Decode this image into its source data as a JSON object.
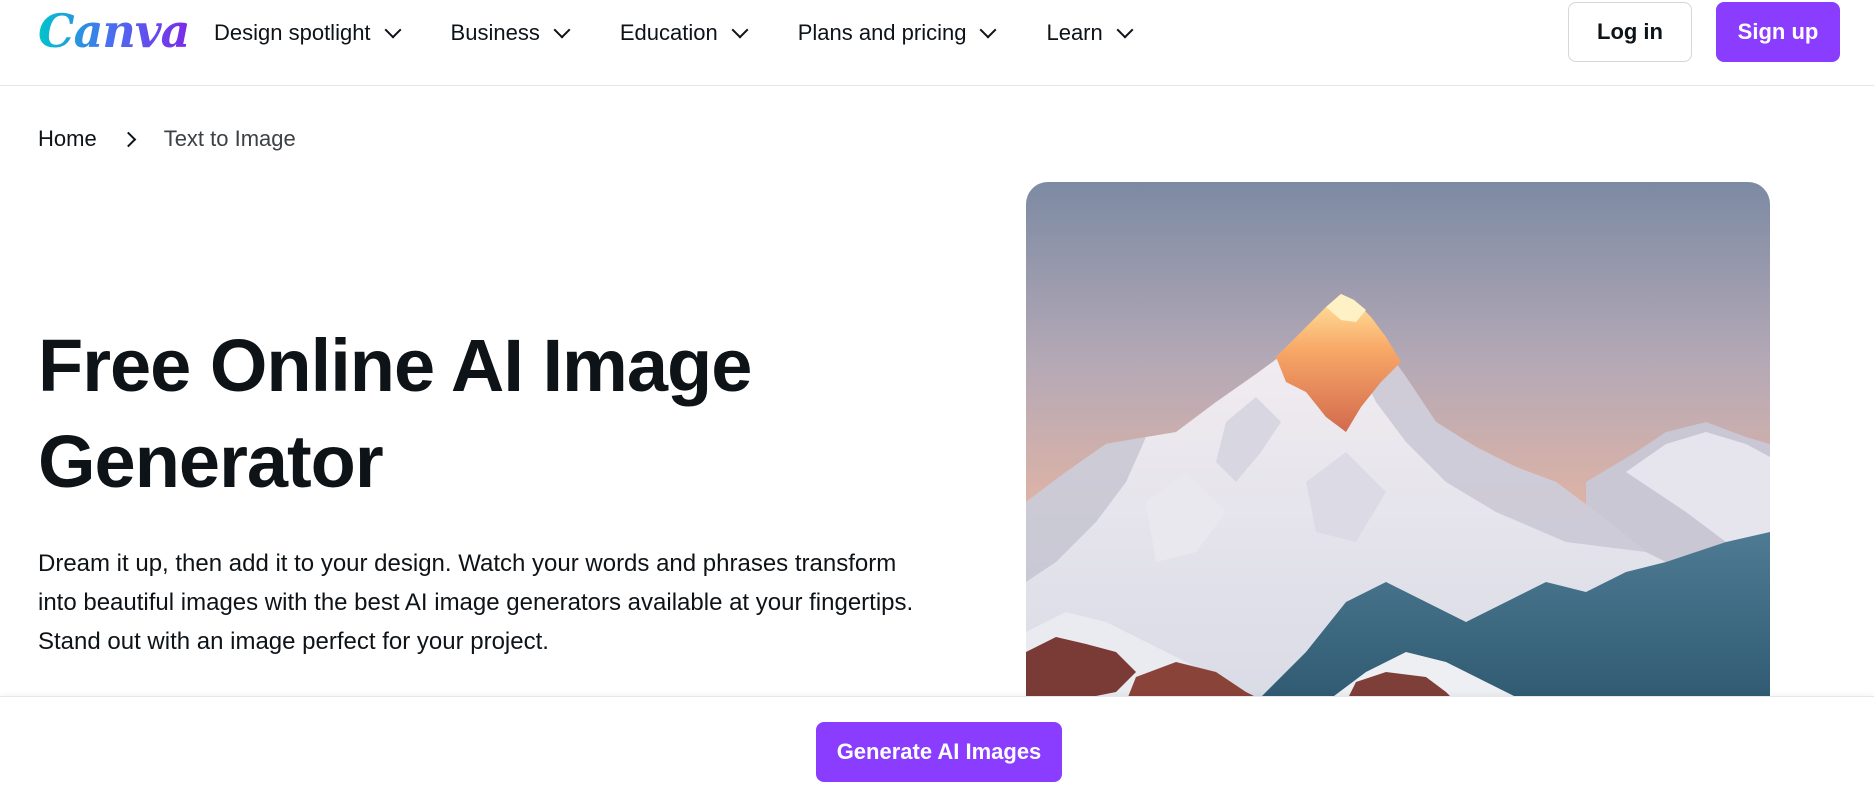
{
  "brand": {
    "logo_text": "Canva"
  },
  "nav": {
    "items": [
      {
        "label": "Design spotlight"
      },
      {
        "label": "Business"
      },
      {
        "label": "Education"
      },
      {
        "label": "Plans and pricing"
      },
      {
        "label": "Learn"
      }
    ],
    "login_label": "Log in",
    "signup_label": "Sign up"
  },
  "breadcrumb": {
    "home": "Home",
    "current": "Text to Image"
  },
  "hero": {
    "title_line1": "Free Online AI Image",
    "title_line2": "Generator",
    "description": "Dream it up, then add it to your design. Watch your words and phrases transform into beautiful images with the best AI image generators available at your fingertips. Stand out with an image perfect for your project."
  },
  "cta": {
    "generate_label": "Generate AI Images"
  },
  "colors": {
    "accent": "#8b3dff",
    "text": "#0e1318"
  }
}
